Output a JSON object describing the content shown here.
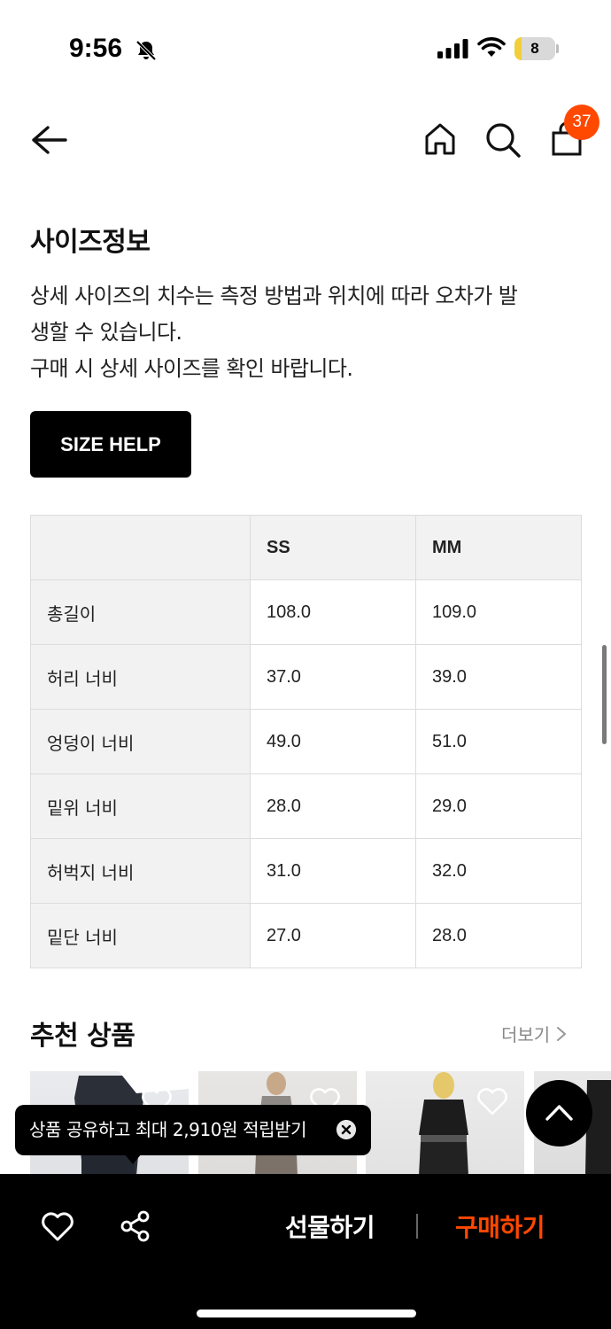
{
  "status_bar": {
    "time": "9:56",
    "battery": "8",
    "battery_level": 0.08
  },
  "header": {
    "cart_count": "37"
  },
  "size_info": {
    "title": "사이즈정보",
    "description_lines": [
      "상세 사이즈의 치수는 측정 방법과 위치에 따라 오차가 발",
      "생할 수 있습니다.",
      "구매 시 상세 사이즈를 확인 바랍니다."
    ],
    "size_help_label": "SIZE HELP",
    "table": {
      "columns": [
        "",
        "SS",
        "MM"
      ],
      "rows": [
        [
          "총길이",
          "108.0",
          "109.0"
        ],
        [
          "허리 너비",
          "37.0",
          "39.0"
        ],
        [
          "엉덩이 너비",
          "49.0",
          "51.0"
        ],
        [
          "밑위 너비",
          "28.0",
          "29.0"
        ],
        [
          "허벅지 너비",
          "31.0",
          "32.0"
        ],
        [
          "밑단 너비",
          "27.0",
          "28.0"
        ]
      ]
    }
  },
  "recommended": {
    "title": "추천 상품",
    "more_label": "더보기"
  },
  "toast": {
    "text": "상품 공유하고 최대 2,910원 적립받기"
  },
  "bottom_bar": {
    "gift_label": "선물하기",
    "buy_label": "구매하기"
  },
  "colors": {
    "accent": "#ff4800",
    "bar_background": "#000000",
    "table_header_bg": "#f2f2f2"
  },
  "icons": [
    "bell-off-icon",
    "signal-icon",
    "wifi-icon",
    "battery-icon",
    "back-arrow-icon",
    "home-icon",
    "search-icon",
    "cart-icon",
    "chevron-right-icon",
    "heart-icon",
    "close-icon",
    "arrow-up-icon",
    "share-icon"
  ]
}
